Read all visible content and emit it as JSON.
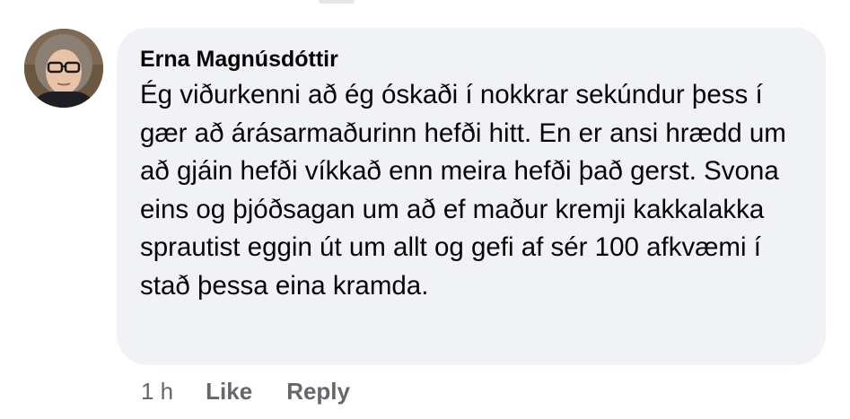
{
  "comment": {
    "author": "Erna Magnúsdóttir",
    "text": "Ég viðurkenni að ég óskaði í nokkrar sekúndur þess í gær að árásarmaðurinn hefði hitt. En er ansi hrædd um að gjáin hefði víkkað enn meira hefði það gerst. Svona eins og þjóðsagan um að ef maður kremji kakkalakka sprautist eggin út um allt og gefi af sér 100 afkvæmi í stað þessa eina kramda.",
    "avatar_icon": "profile-photo"
  },
  "actions": {
    "time": "1 h",
    "like_label": "Like",
    "reply_label": "Reply"
  },
  "colors": {
    "bubble": "#f0f2f5",
    "text": "#050505",
    "secondary": "#65676b"
  }
}
